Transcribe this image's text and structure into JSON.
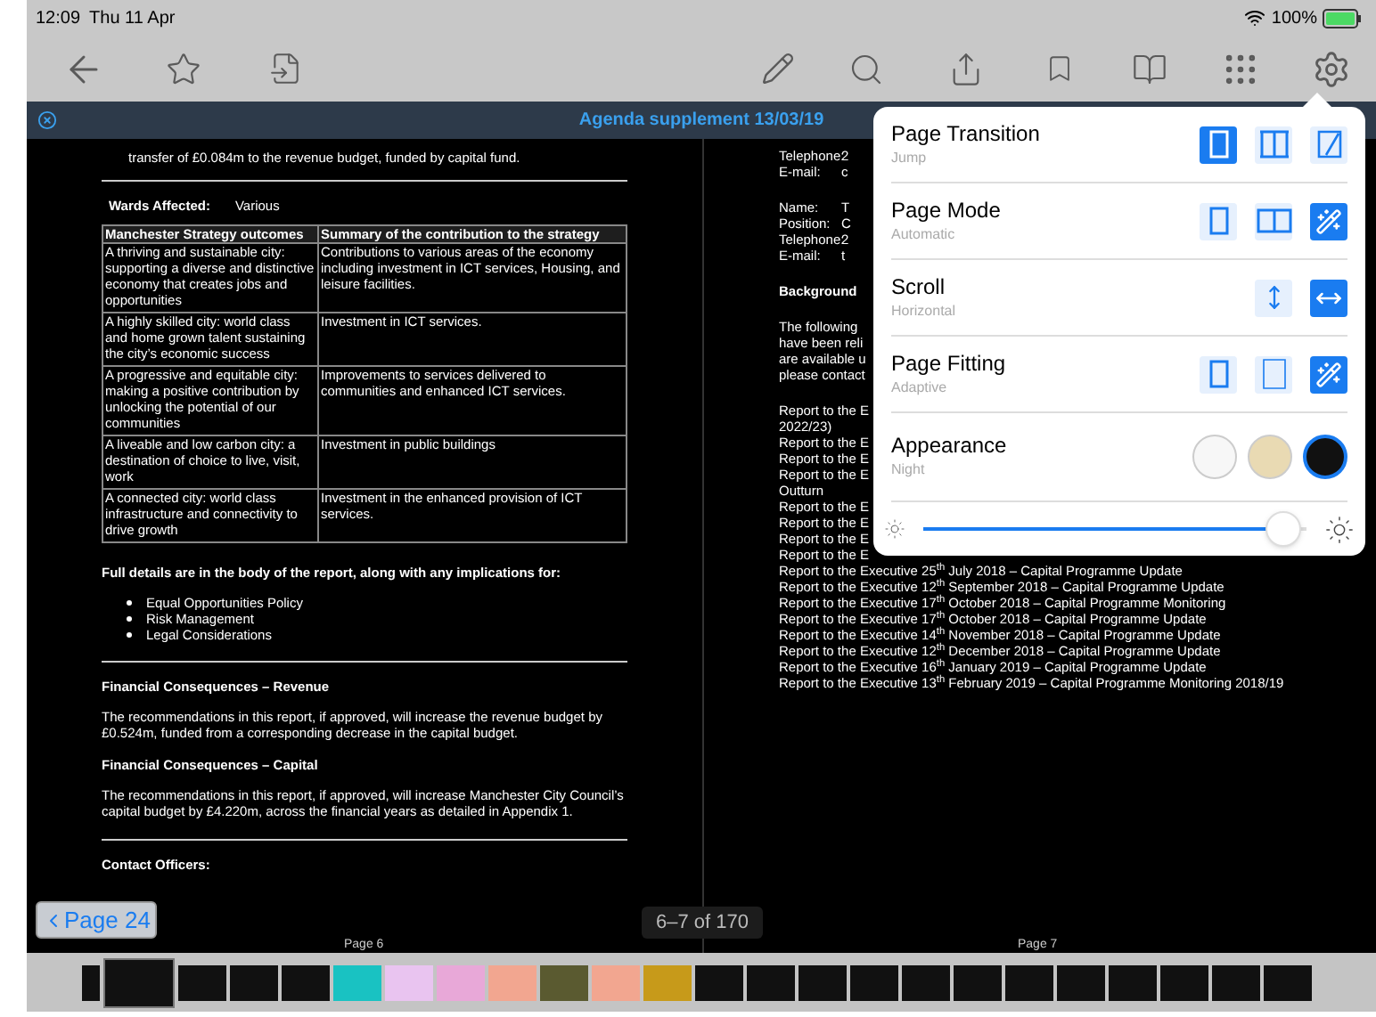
{
  "status_bar": {
    "time": "12:09",
    "date": "Thu 11 Apr",
    "battery": "100%"
  },
  "document": {
    "title": "Agenda supplement 13/03/19",
    "left_page": {
      "blocks": [
        {
          "kind": "indented",
          "text": "transfer of £0.084m to the revenue budget, funded by capital fund."
        },
        {
          "kind": "rule"
        },
        {
          "kind": "field",
          "label": "Wards Affected:",
          "value": "Various"
        },
        {
          "kind": "table",
          "columns": [
            "Manchester Strategy outcomes",
            "Summary of the contribution to the strategy"
          ],
          "rows": [
            [
              "A thriving and sustainable city: supporting a diverse and distinctive economy that creates jobs and opportunities",
              "Contributions to various areas of the economy including investment in ICT services, Housing, and leisure facilities."
            ],
            [
              "A highly skilled city: world class and home grown talent sustaining the city’s economic success",
              "Investment in ICT services."
            ],
            [
              "A progressive and equitable city: making a positive contribution by unlocking the potential of our communities",
              "Improvements to services delivered to communities and enhanced ICT services."
            ],
            [
              "A liveable and low carbon city: a destination of choice to live, visit, work",
              "Investment in public buildings"
            ],
            [
              "A connected city: world class infrastructure and connectivity to drive growth",
              "Investment in the enhanced provision of ICT services."
            ]
          ]
        },
        {
          "kind": "heading",
          "text": "Full details are in the body of the report, along with any implications for:"
        },
        {
          "kind": "bullets",
          "items": [
            "Equal Opportunities Policy",
            "Risk Management",
            "Legal Considerations"
          ]
        },
        {
          "kind": "rule"
        },
        {
          "kind": "heading",
          "text": "Financial Consequences – Revenue"
        },
        {
          "kind": "para",
          "text": "The recommendations in this report, if approved, will increase the revenue budget by £0.524m, funded from a corresponding decrease in the capital budget."
        },
        {
          "kind": "heading",
          "text": "Financial Consequences – Capital"
        },
        {
          "kind": "para",
          "text": "The recommendations in this report, if approved, will increase Manchester City Council’s capital budget by £4.220m, across the financial years as detailed in Appendix 1."
        },
        {
          "kind": "rule"
        },
        {
          "kind": "heading",
          "text": "Contact Officers:"
        }
      ]
    },
    "right_page": {
      "groups": [
        [
          {
            "kind": "field",
            "label": "Telephone:",
            "value": "2"
          },
          {
            "kind": "field",
            "label": "E-mail:",
            "value": "c"
          }
        ],
        [
          {
            "kind": "field",
            "label": "Name:",
            "value": "T"
          },
          {
            "kind": "field",
            "label": "Position:",
            "value": "C"
          },
          {
            "kind": "field",
            "label": "Telephone:",
            "value": "2"
          },
          {
            "kind": "field",
            "label": "E-mail:",
            "value": "t"
          }
        ],
        [
          {
            "kind": "heading",
            "text": "Background"
          }
        ],
        [
          {
            "kind": "text",
            "text": "The following"
          },
          {
            "kind": "text",
            "text": "have been reli"
          },
          {
            "kind": "text",
            "text": "are available u"
          },
          {
            "kind": "text",
            "text": "please contact"
          }
        ],
        [
          {
            "kind": "text",
            "text": "Report to the E"
          },
          {
            "kind": "text",
            "text": "2022/23)"
          },
          {
            "kind": "text",
            "text": "Report to the E"
          },
          {
            "kind": "text",
            "text": "Report to the E"
          },
          {
            "kind": "text",
            "text": "Report to the E"
          },
          {
            "kind": "text",
            "text": "Outturn"
          },
          {
            "kind": "text",
            "text": "Report to the E"
          },
          {
            "kind": "text",
            "text": "Report to the E"
          },
          {
            "kind": "text",
            "text": "Report to the E"
          },
          {
            "kind": "text",
            "text": "Report to the E"
          },
          {
            "kind": "text",
            "text": "Report to the Executive 25$^{th}$ July 2018 – Capital Programme Update"
          },
          {
            "kind": "text",
            "text": "Report to the Executive 12$^{th}$ September 2018 – Capital Programme Update"
          },
          {
            "kind": "text",
            "text": "Report to the Executive 17$^{th}$ October 2018 – Capital Programme Monitoring"
          },
          {
            "kind": "text",
            "text": "Report to the Executive 17$^{th}$ October 2018 – Capital Programme Update"
          },
          {
            "kind": "text",
            "text": "Report to the Executive 14$^{th}$ November 2018 – Capital Programme Update"
          },
          {
            "kind": "text",
            "text": "Report to the Executive 12$^{th}$ December 2018 – Capital Programme Update"
          },
          {
            "kind": "text",
            "text": "Report to the Executive 16$^{th}$ January 2019 – Capital Programme Update"
          },
          {
            "kind": "text",
            "text": "Report to the Executive 13$^{th}$ February 2019 – Capital Programme Monitoring 2018/19"
          }
        ]
      ]
    },
    "back_button": "Page 24",
    "page_counter": "6–7 of 170",
    "page_labels": [
      "Page 6",
      "Page 7"
    ],
    "thumbnails": [
      {
        "selected": false
      },
      {
        "selected": true
      },
      {
        "selected": false
      },
      {
        "selected": false
      },
      {
        "selected": false
      },
      {
        "selected": false
      },
      {
        "selected": false
      },
      {
        "selected": false
      },
      {
        "selected": false
      },
      {
        "selected": false
      },
      {
        "selected": false
      },
      {
        "selected": false
      },
      {
        "selected": false
      },
      {
        "selected": false
      },
      {
        "selected": false
      },
      {
        "selected": false
      },
      {
        "selected": false
      },
      {
        "selected": false
      },
      {
        "selected": false
      },
      {
        "selected": false
      },
      {
        "selected": false
      },
      {
        "selected": false
      },
      {
        "selected": false
      },
      {
        "selected": false
      }
    ]
  },
  "settings_popover": {
    "sections": [
      {
        "title": "Page Transition",
        "value": "Jump",
        "options": [
          {
            "kind": "page",
            "selected": true
          },
          {
            "kind": "slide",
            "selected": false
          },
          {
            "kind": "curl",
            "selected": false
          }
        ]
      },
      {
        "title": "Page Mode",
        "value": "Automatic",
        "options": [
          {
            "kind": "page",
            "selected": false
          },
          {
            "kind": "spread",
            "selected": false
          },
          {
            "kind": "auto",
            "selected": true
          }
        ]
      },
      {
        "title": "Scroll",
        "value": "Horizontal",
        "options": [
          {
            "kind": "vertical",
            "selected": false
          },
          {
            "kind": "horizontal",
            "selected": true
          }
        ]
      },
      {
        "title": "Page Fitting",
        "value": "Adaptive",
        "options": [
          {
            "kind": "page",
            "selected": false
          },
          {
            "kind": "fit",
            "selected": false
          },
          {
            "kind": "auto",
            "selected": true
          }
        ]
      }
    ],
    "appearance": {
      "title": "Appearance",
      "value": "Night",
      "options": [
        {
          "color": "#f7f7f7",
          "selected": false
        },
        {
          "color": "#e9dab3",
          "selected": false
        },
        {
          "color": "#111111",
          "selected": true
        }
      ]
    },
    "brightness": {
      "level": 0.94
    }
  }
}
